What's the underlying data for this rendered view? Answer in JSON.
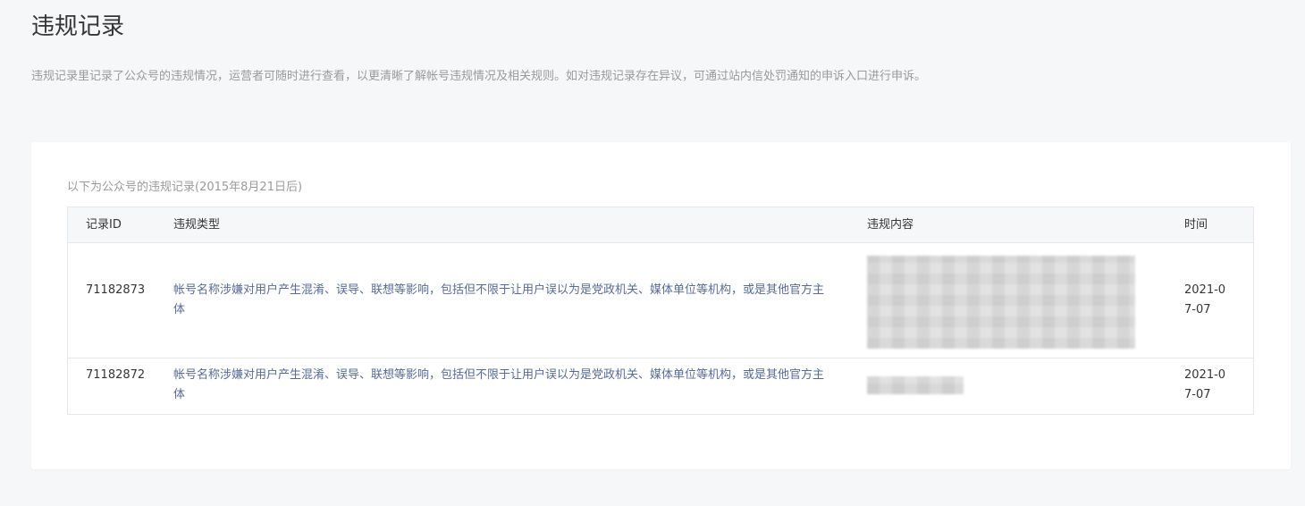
{
  "page": {
    "title": "违规记录",
    "description": "违规记录里记录了公众号的违规情况，运营者可随时进行查看，以更清晰了解帐号违规情况及相关规则。如对违规记录存在异议，可通过站内信处罚通知的申诉入口进行申诉。"
  },
  "card": {
    "caption": "以下为公众号的违规记录(2015年8月21日后)"
  },
  "table": {
    "columns": [
      "记录ID",
      "违规类型",
      "违规内容",
      "时间"
    ],
    "rows": [
      {
        "id": "71182873",
        "type": "帐号名称涉嫌对用户产生混淆、误导、联想等影响，包括但不限于让用户误以为是党政机关、媒体单位等机构，或是其他官方主体",
        "content": "",
        "time": "2021-07-07"
      },
      {
        "id": "71182872",
        "type": "帐号名称涉嫌对用户产生混淆、误导、联想等影响，包括但不限于让用户误以为是党政机关、媒体单位等机构，或是其他官方主体",
        "content": "",
        "time": "2021-07-07"
      }
    ]
  },
  "colors": {
    "background": "#f6f7f9",
    "card": "#ffffff",
    "link": "#576b95",
    "muted": "#9a9a9a",
    "border": "#e7e7eb"
  }
}
